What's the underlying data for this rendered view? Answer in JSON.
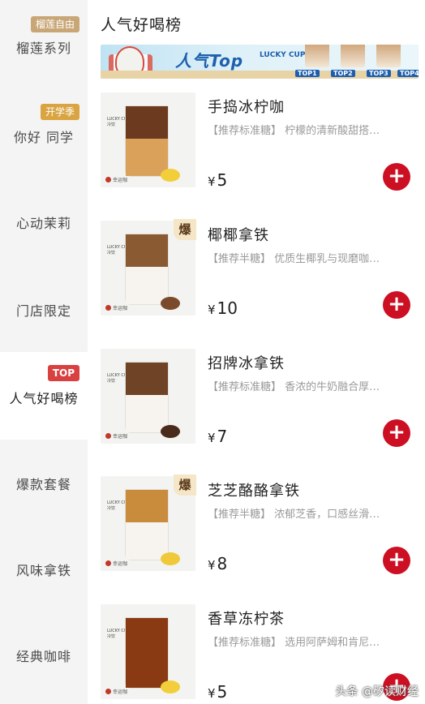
{
  "sidebar": {
    "categories": [
      {
        "label": "榴莲系列",
        "badge": "榴莲自由",
        "badge_color": "#c8a676"
      },
      {
        "label": "你好 同学",
        "badge": "开学季",
        "badge_color": "#d9a441"
      },
      {
        "label": "心动茉莉",
        "badge": ""
      },
      {
        "label": "门店限定",
        "badge": ""
      },
      {
        "label": "人气好喝榜",
        "badge": "TOP",
        "badge_color": "#d94040",
        "active": true
      },
      {
        "label": "爆款套餐",
        "badge": ""
      },
      {
        "label": "风味拿铁",
        "badge": ""
      },
      {
        "label": "经典咖啡",
        "badge": ""
      }
    ]
  },
  "main": {
    "section_title": "人气好喝榜",
    "banner": {
      "text": "人气Top",
      "brand": "LUCKY CUP",
      "tags": [
        "TOP1",
        "TOP2",
        "TOP3",
        "TOP4"
      ]
    },
    "hot_label": "爆",
    "currency": "¥",
    "add_symbol": "+",
    "products": [
      {
        "name": "手捣冰柠咖",
        "desc": "【推荐标准糖】 柠檬的清新酸甜搭…",
        "price": "5",
        "hot": false,
        "drink_top": "#6b3a1f",
        "side_color": "#f2cf3a"
      },
      {
        "name": "椰椰拿铁",
        "desc": "【推荐半糖】 优质生椰乳与现磨咖…",
        "price": "10",
        "hot": true,
        "drink_top": "#8a5a32",
        "side_color": "#7a4a2a"
      },
      {
        "name": "招牌冰拿铁",
        "desc": "【推荐标准糖】 香浓的牛奶融合厚…",
        "price": "7",
        "hot": false,
        "drink_top": "#6e4326",
        "side_color": "#4a2a1a"
      },
      {
        "name": "芝芝酪酪拿铁",
        "desc": "【推荐半糖】 浓郁芝香，口感丝滑…",
        "price": "8",
        "hot": true,
        "drink_top": "#c98b3c",
        "side_color": "#f0c93a"
      },
      {
        "name": "香草冻柠茶",
        "desc": "【推荐标准糖】 选用阿萨姆和肯尼…",
        "price": "5",
        "hot": false,
        "drink_top": "#8a3a12",
        "side_color": "#f2cf3a"
      }
    ]
  },
  "thumb_text": {
    "brand": "幸运咖",
    "cup": "LUCKY CUP",
    "temp": "冷饮"
  },
  "watermark": "头条 @矽读财经"
}
